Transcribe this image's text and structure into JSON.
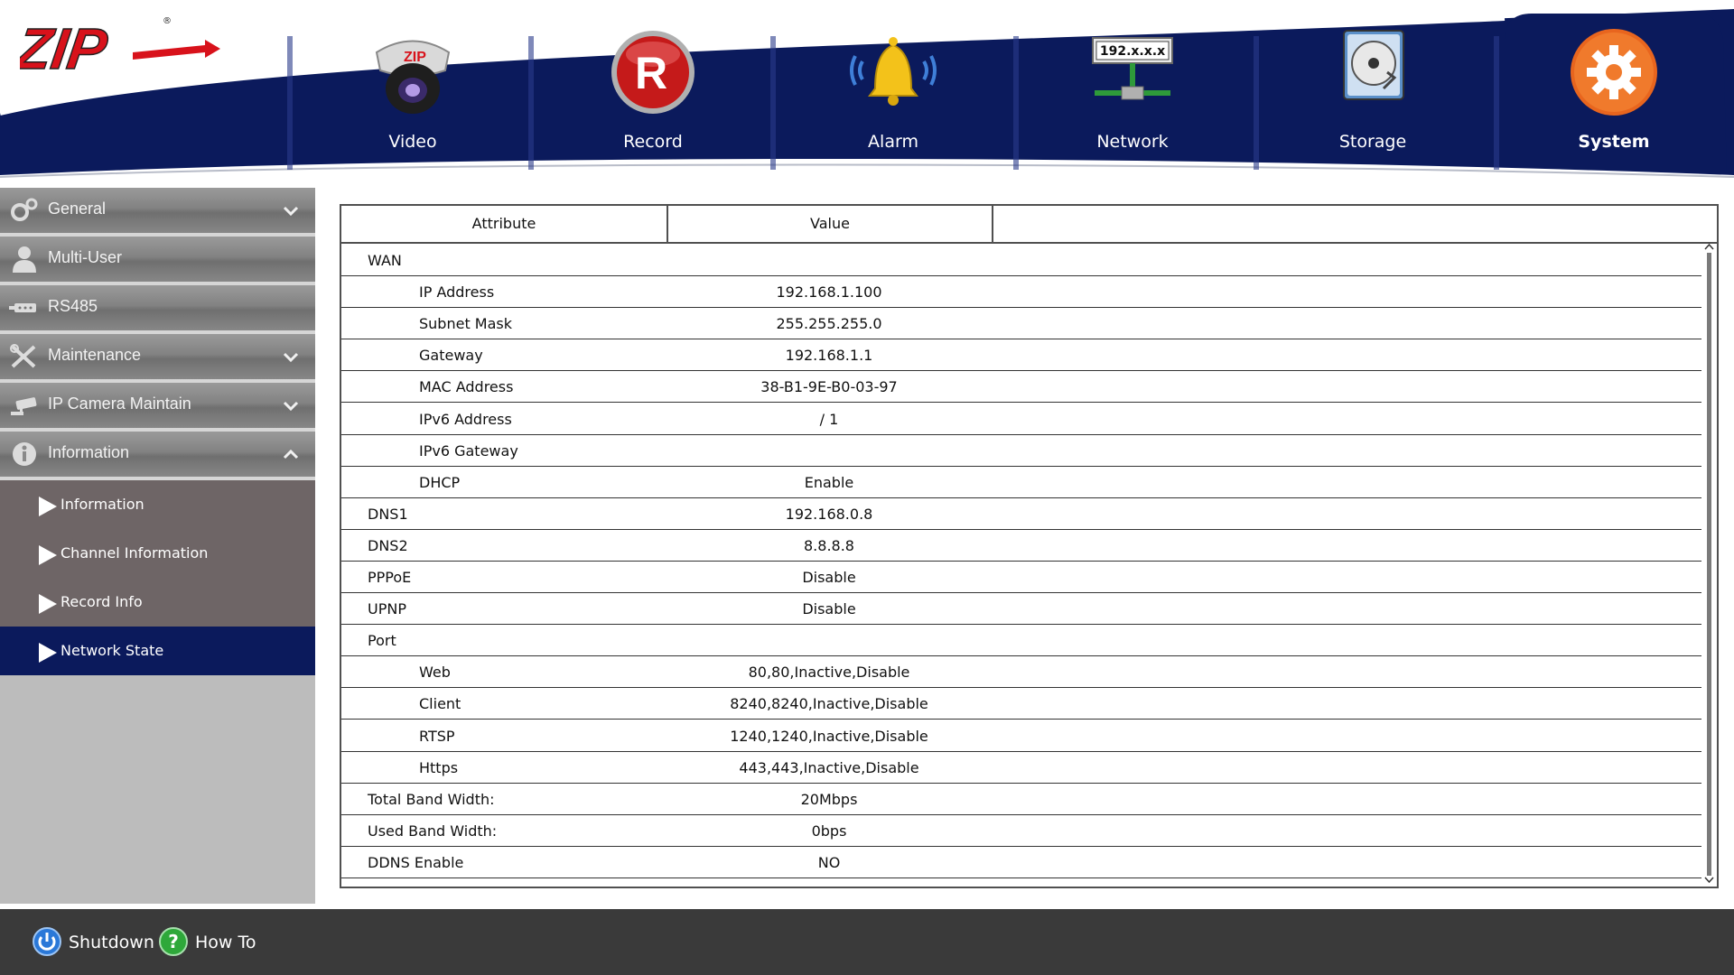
{
  "header": {
    "logo_text": "ZIP",
    "nav": [
      {
        "label": "Video",
        "icon": "camera-icon",
        "active": false
      },
      {
        "label": "Record",
        "icon": "record-icon",
        "active": false
      },
      {
        "label": "Alarm",
        "icon": "bell-icon",
        "active": false
      },
      {
        "label": "Network",
        "icon": "network-icon",
        "active": false
      },
      {
        "label": "Storage",
        "icon": "hard-disk-icon",
        "active": false
      },
      {
        "label": "System",
        "icon": "gear-icon",
        "active": true
      }
    ],
    "network_icon_text": "192.x.x.x"
  },
  "sidebar": {
    "menus": [
      {
        "label": "General",
        "icon": "gears-icon",
        "chevron": "down"
      },
      {
        "label": "Multi-User",
        "icon": "user-icon",
        "chevron": "none"
      },
      {
        "label": "RS485",
        "icon": "serial-port-icon",
        "chevron": "none"
      },
      {
        "label": "Maintenance",
        "icon": "tools-icon",
        "chevron": "down"
      },
      {
        "label": "IP Camera Maintain",
        "icon": "ip-camera-icon",
        "chevron": "down"
      },
      {
        "label": "Information",
        "icon": "info-icon",
        "chevron": "up"
      }
    ],
    "submenus": [
      {
        "label": "Information",
        "active": false
      },
      {
        "label": "Channel Information",
        "active": false
      },
      {
        "label": "Record Info",
        "active": false
      },
      {
        "label": "Network State",
        "active": true
      }
    ]
  },
  "table": {
    "headers": {
      "attribute": "Attribute",
      "value": "Value"
    },
    "rows": [
      {
        "attribute": "WAN",
        "value": "",
        "indent": false
      },
      {
        "attribute": "IP Address",
        "value": "192.168.1.100",
        "indent": true
      },
      {
        "attribute": "Subnet Mask",
        "value": "255.255.255.0",
        "indent": true
      },
      {
        "attribute": "Gateway",
        "value": "192.168.1.1",
        "indent": true
      },
      {
        "attribute": "MAC Address",
        "value": "38-B1-9E-B0-03-97",
        "indent": true
      },
      {
        "attribute": "IPv6 Address",
        "value": "/ 1",
        "indent": true
      },
      {
        "attribute": "IPv6 Gateway",
        "value": "",
        "indent": true
      },
      {
        "attribute": "DHCP",
        "value": "Enable",
        "indent": true
      },
      {
        "attribute": "DNS1",
        "value": "192.168.0.8",
        "indent": false
      },
      {
        "attribute": "DNS2",
        "value": "8.8.8.8",
        "indent": false
      },
      {
        "attribute": "PPPoE",
        "value": "Disable",
        "indent": false
      },
      {
        "attribute": "UPNP",
        "value": "Disable",
        "indent": false
      },
      {
        "attribute": "Port",
        "value": "",
        "indent": false
      },
      {
        "attribute": "Web",
        "value": "80,80,Inactive,Disable",
        "indent": true
      },
      {
        "attribute": "Client",
        "value": "8240,8240,Inactive,Disable",
        "indent": true
      },
      {
        "attribute": "RTSP",
        "value": "1240,1240,Inactive,Disable",
        "indent": true
      },
      {
        "attribute": "Https",
        "value": "443,443,Inactive,Disable",
        "indent": true
      },
      {
        "attribute": "Total Band Width:",
        "value": "20Mbps",
        "indent": false
      },
      {
        "attribute": "Used Band Width:",
        "value": "0bps",
        "indent": false
      },
      {
        "attribute": "DDNS Enable",
        "value": "NO",
        "indent": false
      }
    ]
  },
  "footer": {
    "shutdown_label": "Shutdown",
    "howto_label": "How To"
  },
  "colors": {
    "navy": "#0b1a5c",
    "submenu_bg": "#6e6566",
    "footer_bg": "#3a3a3a",
    "system_orange": "#e8651e"
  }
}
